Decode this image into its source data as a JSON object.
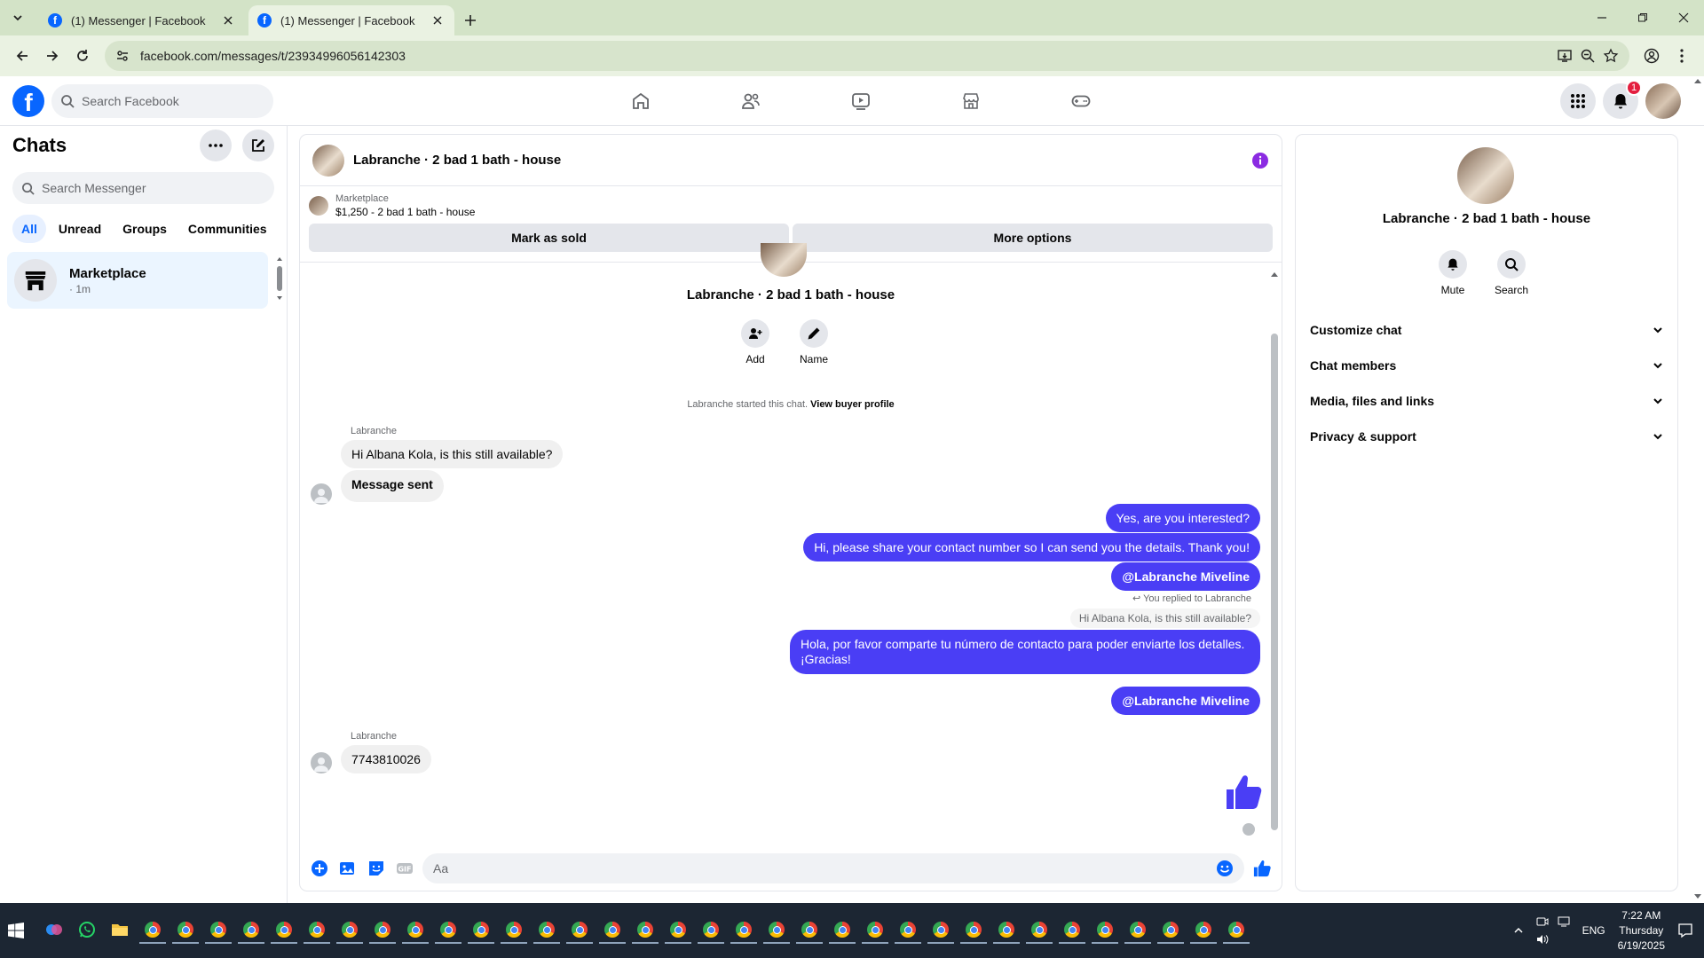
{
  "browser": {
    "tabs": [
      {
        "title": "(1) Messenger | Facebook",
        "active": false
      },
      {
        "title": "(1) Messenger | Facebook",
        "active": true
      }
    ],
    "url": "facebook.com/messages/t/23934996056142303"
  },
  "fb": {
    "search_placeholder": "Search Facebook",
    "notification_count": "1"
  },
  "chats": {
    "title": "Chats",
    "search_placeholder": "Search Messenger",
    "filters": [
      "All",
      "Unread",
      "Groups",
      "Communities"
    ],
    "item": {
      "name": "Marketplace",
      "subtitle": "· 1m"
    }
  },
  "conversation": {
    "title": "Labranche · 2 bad 1 bath - house",
    "marketplace_label": "Marketplace",
    "listing": "$1,250 - 2 bad 1 bath - house",
    "mark_sold": "Mark as sold",
    "more_options": "More options",
    "intro_name": "Labranche · 2 bad 1 bath - house",
    "add_label": "Add",
    "name_label": "Name",
    "started_text": "Labranche started this chat.",
    "buyer_profile_link": "View buyer profile",
    "sender": "Labranche",
    "msg_in_1": "Hi Albana Kola, is this still available?",
    "msg_in_2": "Message sent",
    "msg_out_1": "Yes, are you interested?",
    "msg_out_2": "Hi, please share your contact number so I can send you the details. Thank you!",
    "msg_out_3": "@Labranche Miveline",
    "reply_note": "You replied to Labranche",
    "reply_quote": "Hi Albana Kola, is this still available?",
    "msg_out_4": "Hola, por favor comparte tu número de contacto para poder enviarte los detalles. ¡Gracias!",
    "msg_out_5": "@Labranche Miveline",
    "sender_2": "Labranche",
    "msg_in_3": "7743810026",
    "composer_placeholder": "Aa"
  },
  "info_panel": {
    "name": "Labranche · 2 bad 1 bath - house",
    "mute": "Mute",
    "search": "Search",
    "sections": [
      "Customize chat",
      "Chat members",
      "Media, files and links",
      "Privacy & support"
    ]
  },
  "taskbar": {
    "lang": "ENG",
    "time": "7:22 AM",
    "day": "Thursday",
    "date": "6/19/2025"
  },
  "colors": {
    "accent": "#0866ff",
    "outgoing_bubble": "#4a3ef5",
    "info_icon": "#8b2be2"
  }
}
